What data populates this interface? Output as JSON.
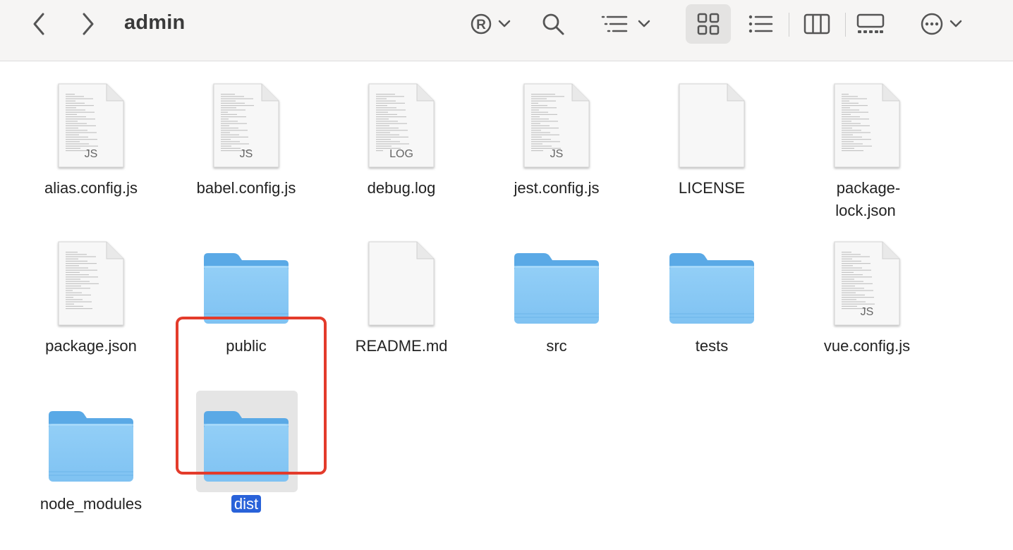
{
  "toolbar": {
    "title": "admin",
    "icons": [
      "chevron-left-icon",
      "chevron-right-icon",
      "registered-icon",
      "chevron-down-icon",
      "search-icon",
      "sort-list-icon",
      "icon-grid-view-icon",
      "list-view-icon",
      "column-view-icon",
      "gallery-view-icon",
      "more-icon"
    ]
  },
  "files": [
    {
      "name": "alias.config.js",
      "kind": "doc",
      "ext": "JS"
    },
    {
      "name": "babel.config.js",
      "kind": "doc",
      "ext": "JS"
    },
    {
      "name": "debug.log",
      "kind": "doc",
      "ext": "LOG"
    },
    {
      "name": "jest.config.js",
      "kind": "doc",
      "ext": "JS"
    },
    {
      "name": "LICENSE",
      "kind": "doc",
      "ext": ""
    },
    {
      "name": "package-lock.json",
      "kind": "doc",
      "ext": ""
    },
    {
      "name": "package.json",
      "kind": "doc",
      "ext": ""
    },
    {
      "name": "public",
      "kind": "folder"
    },
    {
      "name": "README.md",
      "kind": "doc",
      "ext": ""
    },
    {
      "name": "src",
      "kind": "folder"
    },
    {
      "name": "tests",
      "kind": "folder"
    },
    {
      "name": "vue.config.js",
      "kind": "doc",
      "ext": "JS"
    },
    {
      "name": "node_modules",
      "kind": "folder"
    },
    {
      "name": "dist",
      "kind": "folder",
      "selected": true
    }
  ],
  "colors": {
    "folder_body": "#8ecbf5",
    "folder_tab": "#5aa9e6",
    "selection": "#2962d9",
    "highlight": "#e33b2b"
  }
}
